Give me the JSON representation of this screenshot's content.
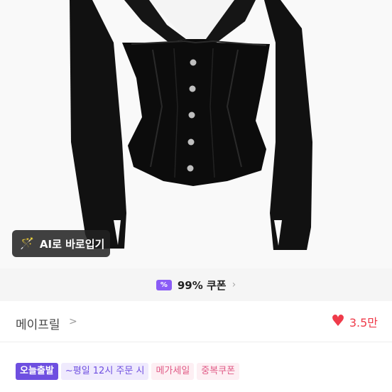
{
  "ai_button": {
    "label": "AI로 바로입기",
    "icon": "magic-wand-icon"
  },
  "coupon": {
    "text": "99% 쿠폰",
    "icon": "coupon-ticket-icon",
    "icon_glyph": "%"
  },
  "seller": {
    "name": "메이프릴",
    "chevron": ">"
  },
  "likes": {
    "count": "3.5만",
    "icon": "heart-icon"
  },
  "badges": [
    "오늘출발",
    "~평일 12시 주문 시",
    "메가세일",
    "중복쿠폰"
  ],
  "colors": {
    "heart": "#ef3b4a",
    "coupon_purple": "#8a5cf6",
    "badge_purple": "#6e4fe0",
    "badge_pink": "#e05a86"
  }
}
